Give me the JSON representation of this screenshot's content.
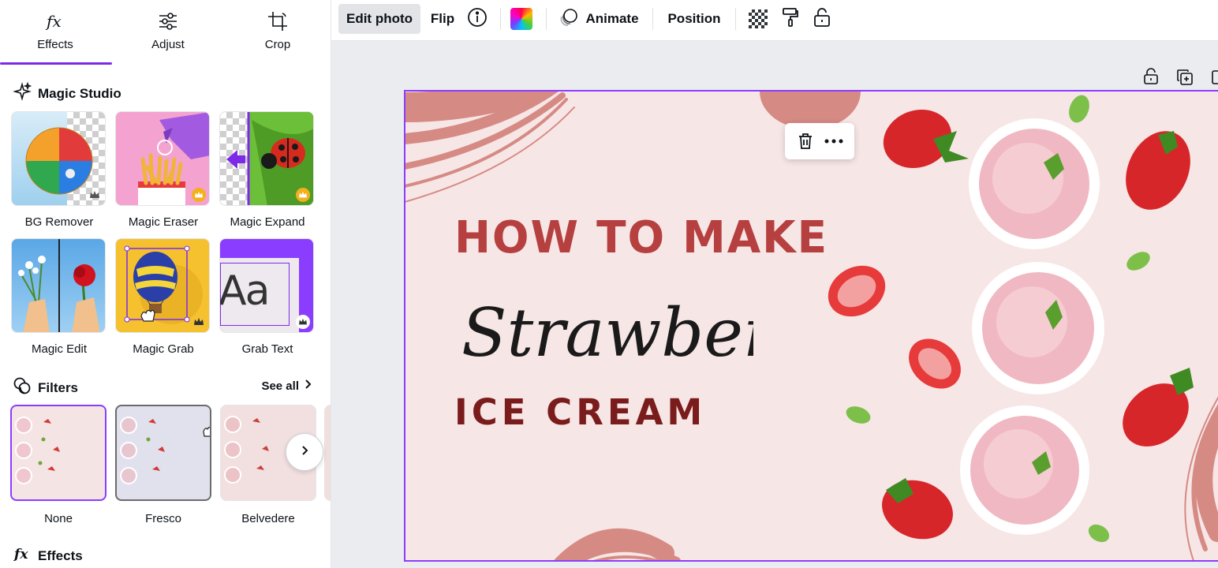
{
  "tabs": [
    {
      "label": "Effects",
      "icon": "fx-icon"
    },
    {
      "label": "Adjust",
      "icon": "sliders-icon"
    },
    {
      "label": "Crop",
      "icon": "crop-icon"
    }
  ],
  "magic_studio": {
    "title": "Magic Studio",
    "tools": [
      {
        "label": "BG Remover"
      },
      {
        "label": "Magic Eraser"
      },
      {
        "label": "Magic Expand"
      },
      {
        "label": "Magic Edit"
      },
      {
        "label": "Magic Grab"
      },
      {
        "label": "Grab Text",
        "thumb_text": "Aa"
      }
    ]
  },
  "filters": {
    "title": "Filters",
    "see_all": "See all",
    "items": [
      {
        "label": "None",
        "selected": true
      },
      {
        "label": "Fresco"
      },
      {
        "label": "Belvedere"
      }
    ]
  },
  "effects_section": {
    "title": "Effects"
  },
  "toolbar": {
    "edit_photo": "Edit photo",
    "flip": "Flip",
    "animate": "Animate",
    "position": "Position"
  },
  "design": {
    "line1": "HOW TO MAKE",
    "line2": "Strawberry",
    "line3": "ICE CREAM"
  },
  "colors": {
    "accent": "#7d2ae8",
    "selection": "#8b3dff",
    "title_red": "#b5403f",
    "title_dark": "#7a1c1c",
    "bg_pink": "#f7e6e6",
    "brush": "#d68a84"
  }
}
